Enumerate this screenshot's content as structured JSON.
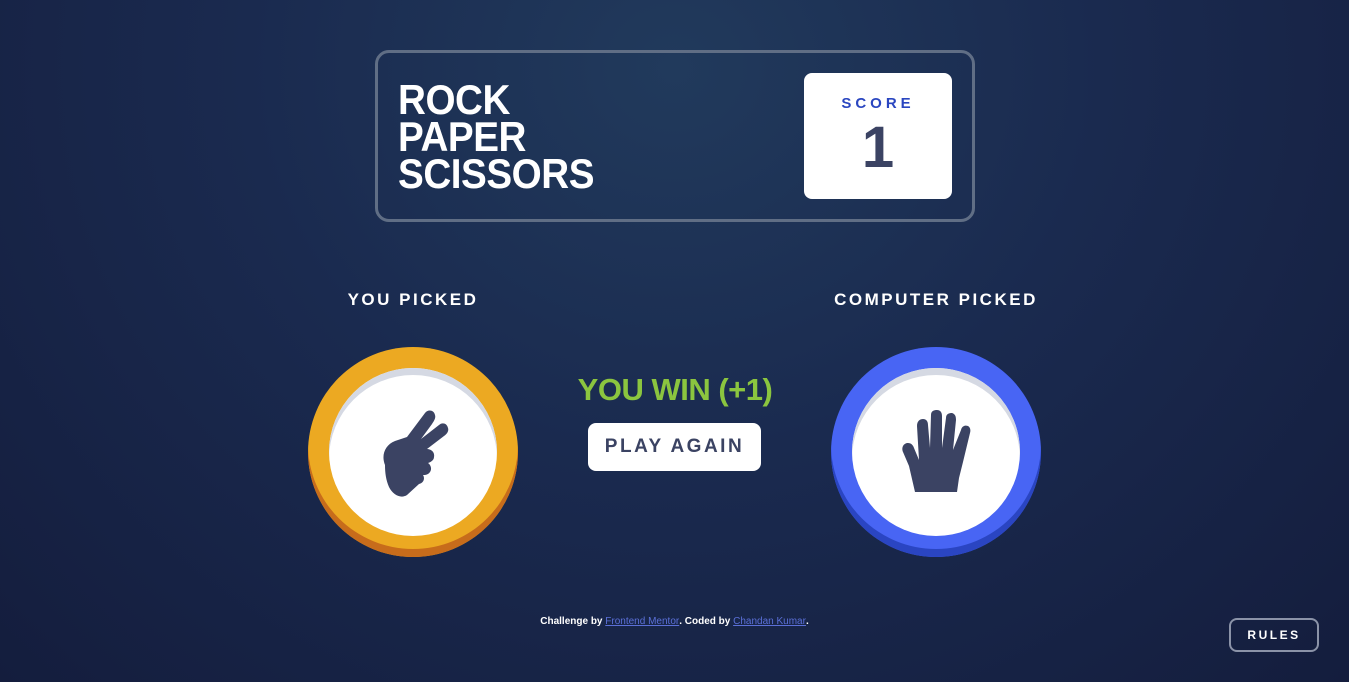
{
  "header": {
    "title_lines": [
      "ROCK",
      "PAPER",
      "SCISSORS"
    ],
    "score_label": "SCORE",
    "score_value": "1"
  },
  "game": {
    "user_label": "YOU PICKED",
    "computer_label": "COMPUTER PICKED",
    "user_pick": {
      "name": "scissors",
      "icon": "scissors-hand-icon",
      "ring_color": "#eca922"
    },
    "computer_pick": {
      "name": "paper",
      "icon": "paper-hand-icon",
      "ring_color": "#4865f4"
    },
    "result_text": "YOU WIN (+1)",
    "result_color": "#8bc53f",
    "play_again_label": "PLAY AGAIN"
  },
  "footer": {
    "challenge_prefix": "Challenge by",
    "challenge_link": "Frontend Mentor",
    "coded_prefix": ". Coded by",
    "coded_link": "Chandan Kumar",
    "suffix": "."
  },
  "rules_button": "RULES"
}
